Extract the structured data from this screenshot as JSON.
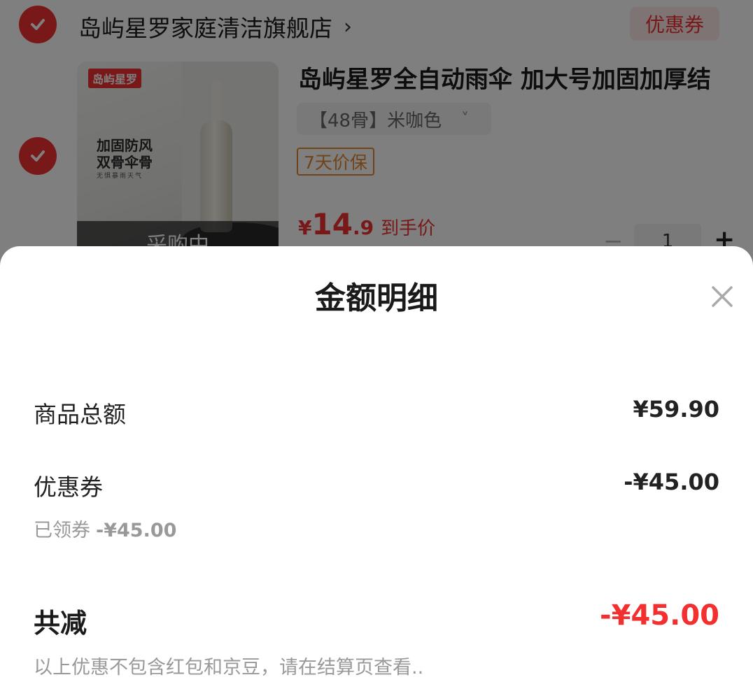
{
  "cart": {
    "shop_name": "岛屿星罗家庭清洁旗舰店",
    "shop_chevron": "›",
    "coupon_button": "优惠券",
    "product": {
      "title": "岛屿星罗全自动雨伞 加大号加固加厚结",
      "sku": "【48骨】米咖色",
      "sku_chevron": "˅",
      "guarantee_tag": "7天价保",
      "price_symbol": "¥",
      "price_int": "14",
      "price_dec": ".9",
      "price_label": "到手价",
      "quantity": "1",
      "minus": "−",
      "plus": "+",
      "image": {
        "logo_text": "岛屿星罗",
        "slogan_line1": "加固防风",
        "slogan_line2": "双骨伞骨",
        "slogan_line3": "无惧暴雨天气",
        "overlay": "采购中"
      }
    }
  },
  "sheet": {
    "title": "金额明细",
    "rows": [
      {
        "label": "商品总额",
        "value": "¥59.90"
      },
      {
        "label": "优惠券",
        "value": "-¥45.00"
      }
    ],
    "coupon_detail": {
      "label": "已领券",
      "amount": "-¥45.00"
    },
    "total": {
      "label": "共减",
      "value": "-¥45.00"
    },
    "note": "以上优惠不包含红包和京豆，请在结算页查看.."
  },
  "colors": {
    "accent_red": "#f23030",
    "guarantee_orange": "#e2862f",
    "muted_text": "#999999"
  },
  "icons": [
    "check-icon",
    "chevron-right-icon",
    "chevron-down-icon",
    "close-icon"
  ]
}
